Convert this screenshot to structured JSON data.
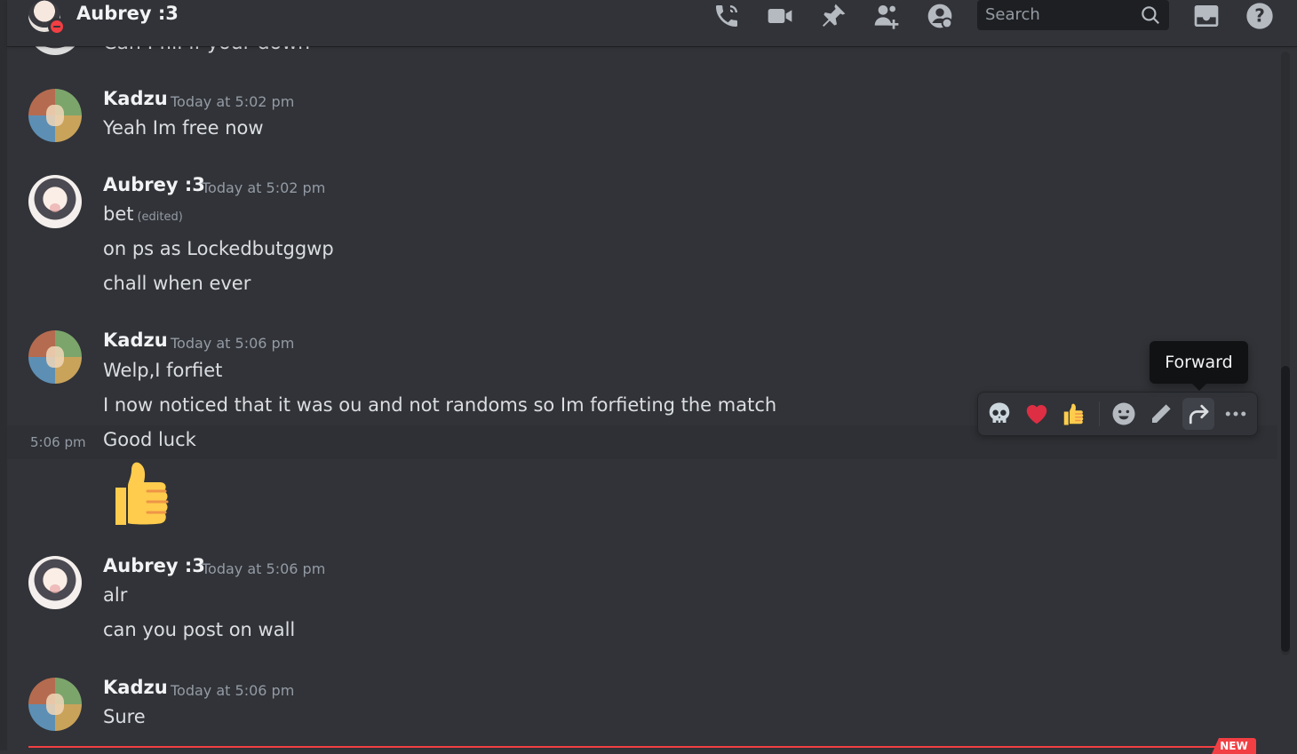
{
  "header": {
    "title": "Aubrey :3",
    "search_placeholder": "Search",
    "icons": [
      "call-icon",
      "video-icon",
      "pin-icon",
      "add-member-icon",
      "user-profile-icon",
      "inbox-icon",
      "help-icon"
    ]
  },
  "clipped_message": {
    "text": "Can I fill if your down"
  },
  "messages": [
    {
      "author": "Kadzu",
      "timestamp": "Today at 5:02 pm",
      "lines": [
        "Yeah Im free now"
      ]
    },
    {
      "author": "Aubrey :3",
      "timestamp": "Today at 5:02 pm",
      "lines": [
        "bet",
        "on ps as Lockedbutggwp",
        "chall when ever"
      ],
      "edited_label": "(edited)"
    },
    {
      "author": "Kadzu",
      "timestamp": "Today at 5:06 pm",
      "lines": [
        "Welp,I forfiet",
        "I now noticed that it was ou and not randoms so Im forfieting the match",
        "Good luck"
      ],
      "hover_time": "5:06 pm"
    },
    {
      "author": "Aubrey :3",
      "timestamp": "Today at 5:06 pm",
      "lines": [
        "alr",
        "can you post on wall"
      ]
    },
    {
      "author": "Kadzu",
      "timestamp": "Today at 5:06 pm",
      "lines": [
        "Sure"
      ]
    }
  ],
  "toolbar": {
    "quick_reactions": [
      "skull-emoji",
      "red-heart-emoji",
      "thumbs-up-emoji"
    ],
    "actions": [
      "add-reaction-icon",
      "edit-icon",
      "forward-icon",
      "more-icon"
    ],
    "tooltip": "Forward"
  },
  "divider": {
    "label": "NEW"
  },
  "colors": {
    "background": "#313338",
    "accent_red": "#f23f43",
    "text": "#dbdee1",
    "muted": "#949ba4"
  }
}
